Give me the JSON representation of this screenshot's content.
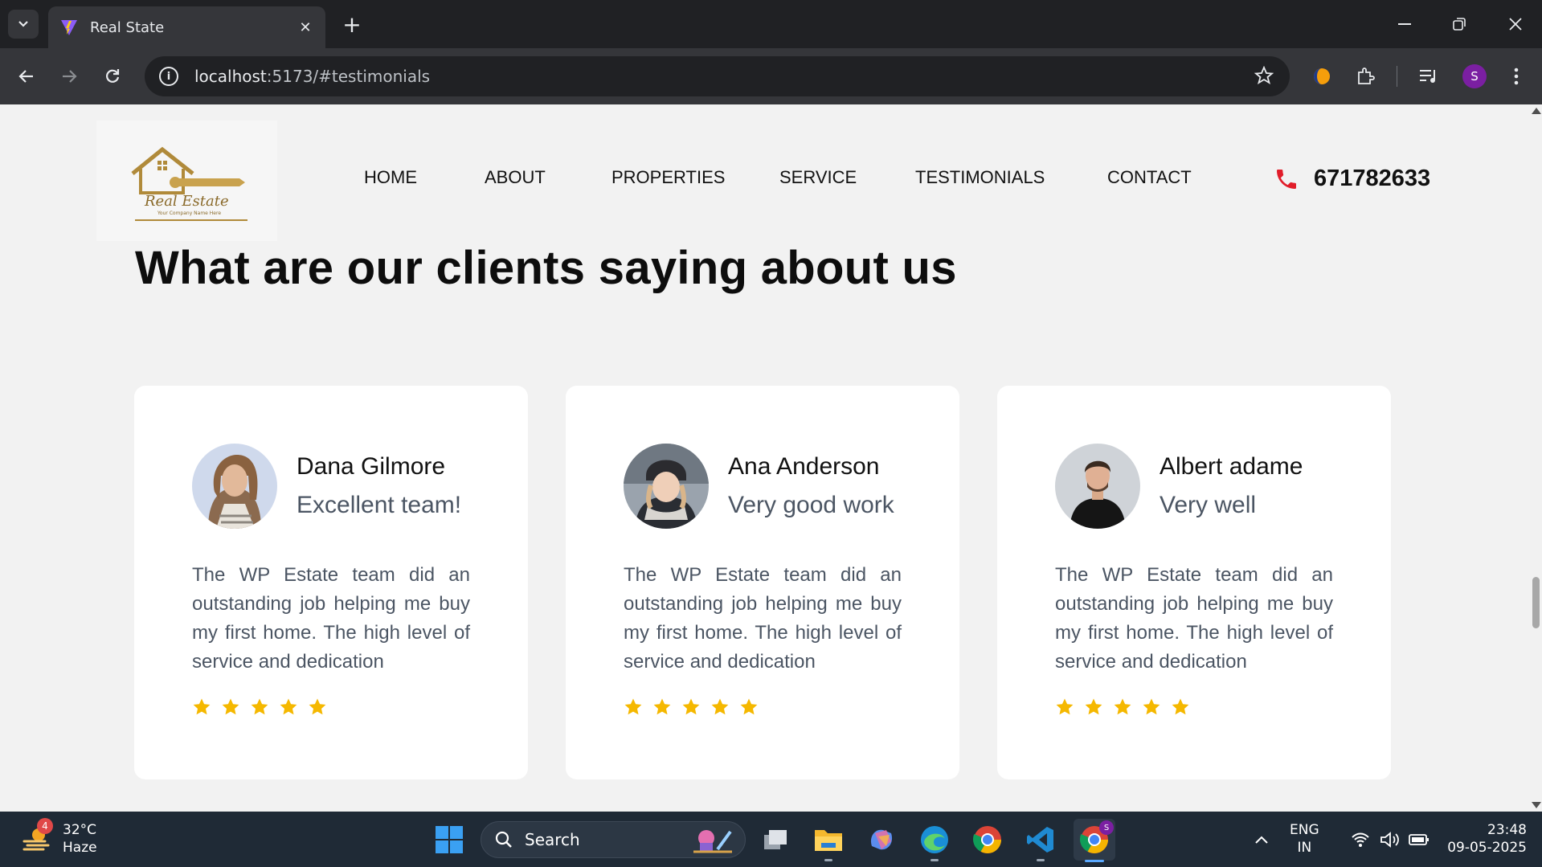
{
  "browser": {
    "tab_title": "Real State",
    "url_host": "localhost",
    "url_path": ":5173/#testimonials",
    "profile_initial": "S"
  },
  "site": {
    "logo_text": "Real Estate",
    "logo_subtext": "Your Company Name Here",
    "nav": [
      "HOME",
      "ABOUT",
      "PROPERTIES",
      "SERVICE",
      "TESTIMONIALS",
      "CONTACT"
    ],
    "phone": "671782633",
    "accent_color": "#e11d2a",
    "star_color": "#f5b800"
  },
  "testimonials": {
    "heading": "What are our clients saying about us",
    "items": [
      {
        "name": "Dana Gilmore",
        "role": "Excellent team!",
        "text": "The WP Estate team did an outstanding job helping me buy my first home. The high level of service and dedication",
        "rating": 5
      },
      {
        "name": "Ana Anderson",
        "role": "Very good work",
        "text": "The WP Estate team did an outstanding job helping me buy my first home. The high level of service and dedication",
        "rating": 5
      },
      {
        "name": "Albert adame",
        "role": "Very well",
        "text": "The WP Estate team did an outstanding job helping me buy my first home. The high level of service and dedication",
        "rating": 5
      }
    ]
  },
  "taskbar": {
    "weather_badge": "4",
    "temperature": "32°C",
    "condition": "Haze",
    "search_label": "Search",
    "lang_top": "ENG",
    "lang_bottom": "IN",
    "time": "23:48",
    "date": "09-05-2025",
    "chrome_badge": "S"
  }
}
